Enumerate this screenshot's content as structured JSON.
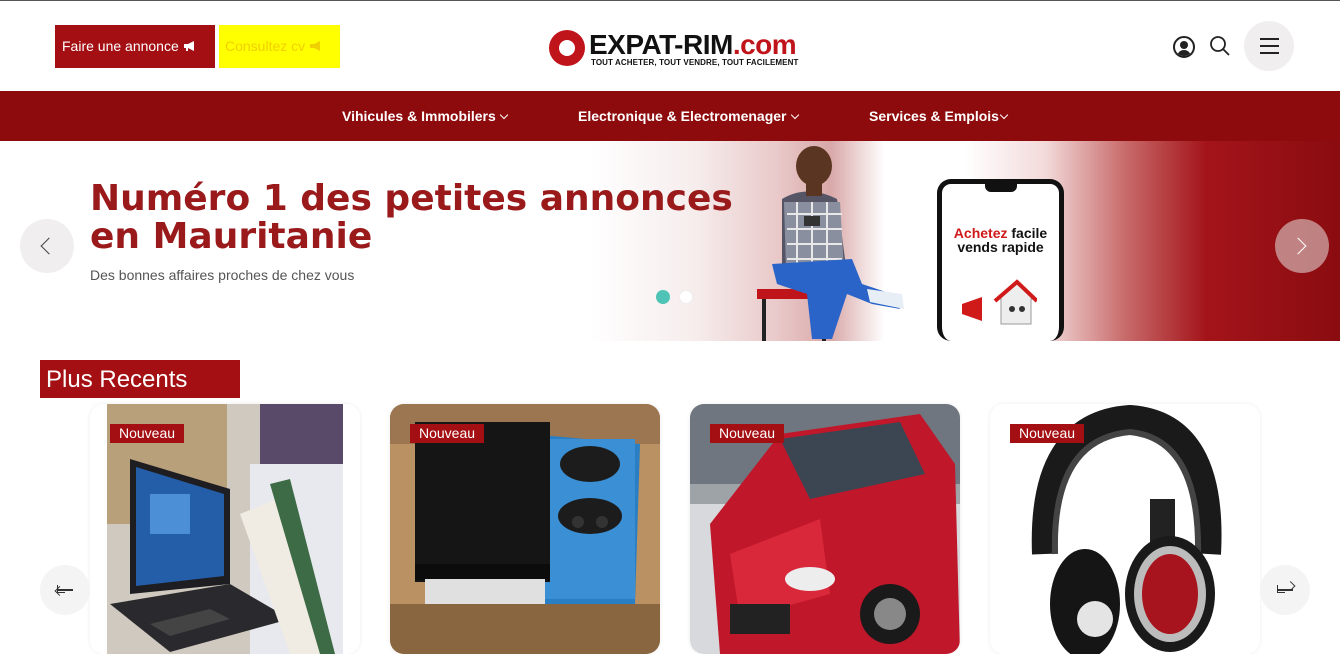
{
  "header": {
    "post_ad_label": "Faire une annonce",
    "cv_label": "Consultez cv",
    "logo_text": "EXPAT-RIM",
    "logo_tld": ".com",
    "logo_tagline": "TOUT ACHETER, TOUT VENDRE, TOUT FACILEMENT",
    "icons": [
      "megaphone-icon",
      "user-icon",
      "search-icon",
      "hamburger-menu-icon"
    ]
  },
  "nav": {
    "items": [
      {
        "label": "Vihicules & Immobilers"
      },
      {
        "label": "Electronique & Electromenager"
      },
      {
        "label": "Services & Emplois"
      }
    ]
  },
  "hero": {
    "title": "Numéro 1 des petites annonces en Mauritanie",
    "subtitle": "Des bonnes affaires proches de chez vous",
    "phone_line1_red": "Achetez",
    "phone_line1_black": "facile",
    "phone_line2": "vends rapide",
    "active_slide": 1,
    "slide_count": 2
  },
  "recent": {
    "title": "Plus Recents",
    "items": [
      {
        "badge": "Nouveau",
        "image": "laptop"
      },
      {
        "badge": "Nouveau",
        "image": "game-console"
      },
      {
        "badge": "Nouveau",
        "image": "red-car"
      },
      {
        "badge": "Nouveau",
        "image": "headphones"
      }
    ]
  },
  "colors": {
    "brand_red": "#a30f12",
    "nav_red": "#8e0b0d",
    "cv_yellow": "#ffff00",
    "title_red": "#9a1a1c",
    "dot_active": "#4fc3b5"
  }
}
